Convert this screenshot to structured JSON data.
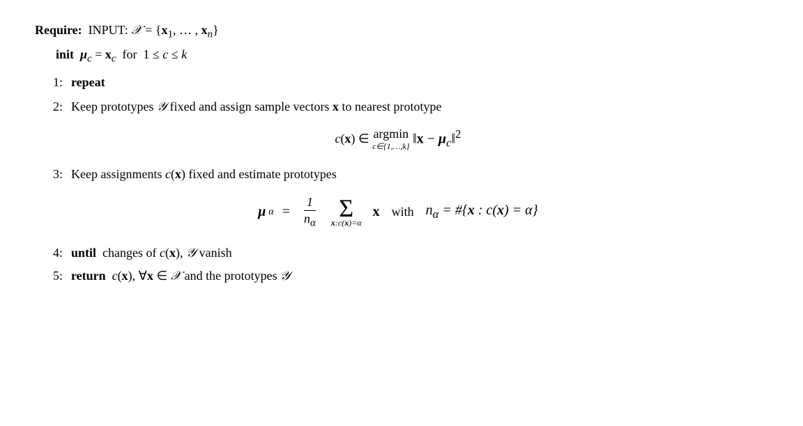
{
  "algorithm": {
    "require_label": "Require:",
    "require_text": "INPUT:",
    "set_notation": "𝒳 = {x₁, ..., xₙ}",
    "init_label": "init",
    "init_formula": "μc = xc for 1 ≤ c ≤ k",
    "steps": [
      {
        "number": "1:",
        "keyword": "repeat",
        "text": ""
      },
      {
        "number": "2:",
        "keyword": "",
        "text": "Keep prototypes 𝒴 fixed and assign sample vectors x to nearest prototype"
      },
      {
        "number": "3:",
        "keyword": "",
        "text": "Keep assignments c(x) fixed and estimate prototypes"
      },
      {
        "number": "4:",
        "keyword": "until",
        "text": "changes of c(x), 𝒴 vanish"
      },
      {
        "number": "5:",
        "keyword": "return",
        "text": "c(x), ∀x ∈ 𝒳 and the prototypes 𝒴"
      }
    ],
    "formula1_display": "c(x) ∈ argmin ‖x − μc‖²",
    "formula1_sub": "c∈{1,...,k}",
    "formula2_display": "μα = (1/nα) Σ x   with   nα = #{x : c(x) = α}",
    "formula2_sub": "x:c(x)=α"
  }
}
